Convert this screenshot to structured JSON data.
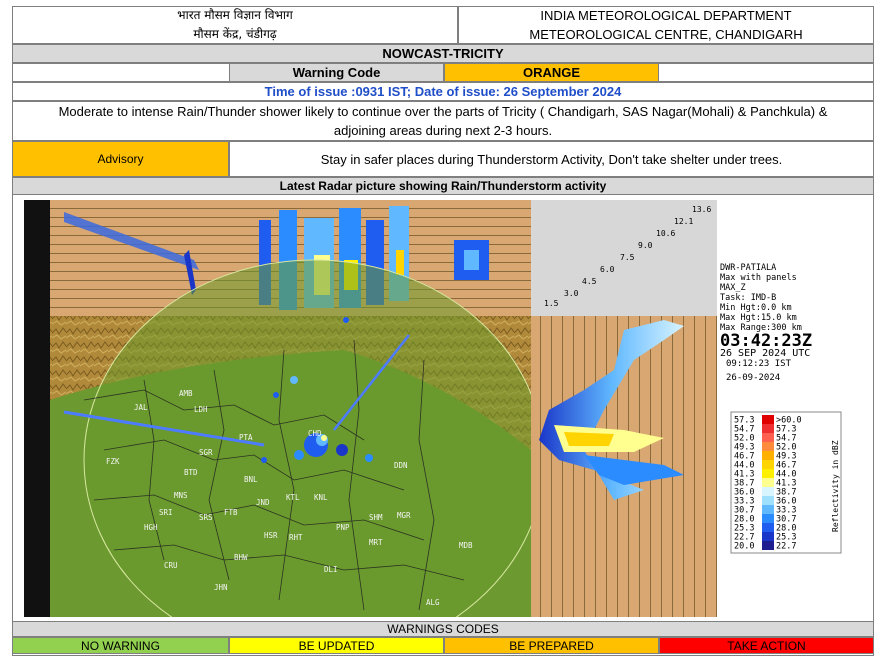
{
  "header": {
    "hindi_line1": "भारत  मौसम  विज्ञान  विभाग",
    "hindi_line2": "मौसम  केंद्र, चंडीगढ़",
    "english_line1": "INDIA METEOROLOGICAL DEPARTMENT",
    "english_line2": "METEOROLOGICAL CENTRE, CHANDIGARH"
  },
  "title": "NOWCAST-TRICITY",
  "warning": {
    "label": "Warning Code",
    "value": "ORANGE",
    "color": "#ffc000"
  },
  "issue_time": "Time of issue :0931 IST; Date of issue: 26 September 2024",
  "message": "Moderate to intense Rain/Thunder shower likely to continue over the parts of Tricity ( Chandigarh, SAS Nagar(Mohali) & Panchkula) & adjoining areas during next 2-3 hours.",
  "advisory": {
    "label": "Advisory",
    "text": "Stay in safer places during Thunderstorm Activity, Don't take shelter under trees."
  },
  "radar_caption": "Latest Radar picture showing Rain/Thunderstorm activity",
  "radar": {
    "height_labels": [
      "13.6",
      "12.1",
      "10.6",
      "9.0",
      "7.5",
      "6.0",
      "4.5",
      "3.0",
      "1.5"
    ],
    "info_lines": [
      "DWR-PATIALA",
      "Max with panels",
      "MAX_Z",
      "Task: IMD-B",
      "Min Hgt:0.0 km",
      "Max Hgt:15.0 km",
      "Max Range:300 km"
    ],
    "utc_time": "03:42:23Z",
    "utc_date": "26 SEP 2024 UTC",
    "ist_time": "09:12:23 IST",
    "ist_date": "26-09-2024",
    "legend_title": "Reflectivity in dBZ",
    "legend": [
      {
        "lo": "57.3",
        "hi": ">60.0",
        "color": "#e00000"
      },
      {
        "lo": "54.7",
        "hi": "57.3",
        "color": "#f03030"
      },
      {
        "lo": "52.0",
        "hi": "54.7",
        "color": "#ff6050"
      },
      {
        "lo": "49.3",
        "hi": "52.0",
        "color": "#ff8c3c"
      },
      {
        "lo": "46.7",
        "hi": "49.3",
        "color": "#ffb000"
      },
      {
        "lo": "44.0",
        "hi": "46.7",
        "color": "#ffd400"
      },
      {
        "lo": "41.3",
        "hi": "44.0",
        "color": "#fff000"
      },
      {
        "lo": "38.7",
        "hi": "41.3",
        "color": "#ffff90"
      },
      {
        "lo": "36.0",
        "hi": "38.7",
        "color": "#d8f4ff"
      },
      {
        "lo": "33.3",
        "hi": "36.0",
        "color": "#a0e0ff"
      },
      {
        "lo": "30.7",
        "hi": "33.3",
        "color": "#60b8ff"
      },
      {
        "lo": "28.0",
        "hi": "30.7",
        "color": "#2a8cff"
      },
      {
        "lo": "25.3",
        "hi": "28.0",
        "color": "#1f5cf0"
      },
      {
        "lo": "22.7",
        "hi": "25.3",
        "color": "#1a36c8"
      },
      {
        "lo": "20.0",
        "hi": "22.7",
        "color": "#1e1e90"
      }
    ],
    "map_labels": [
      "CHD",
      "AMB",
      "PTA",
      "LDH",
      "JAL",
      "SGR",
      "BTD",
      "FZK",
      "MNS",
      "HSR",
      "SRS",
      "KTL",
      "KNL",
      "SHM",
      "DDN",
      "MRT",
      "JND",
      "PNP",
      "RHT",
      "DLI",
      "JHN",
      "HGH",
      "BHW",
      "MDB",
      "ALG",
      "CRU",
      "FTB",
      "BNL",
      "SRI",
      "MGR"
    ]
  },
  "warning_codes": {
    "title": "WARNINGS CODES",
    "items": [
      {
        "label": "NO WARNING",
        "color": "#92d050"
      },
      {
        "label": "BE UPDATED",
        "color": "#ffff00"
      },
      {
        "label": "BE PREPARED",
        "color": "#ffc000"
      },
      {
        "label": "TAKE ACTION",
        "color": "#ff0000"
      }
    ]
  }
}
